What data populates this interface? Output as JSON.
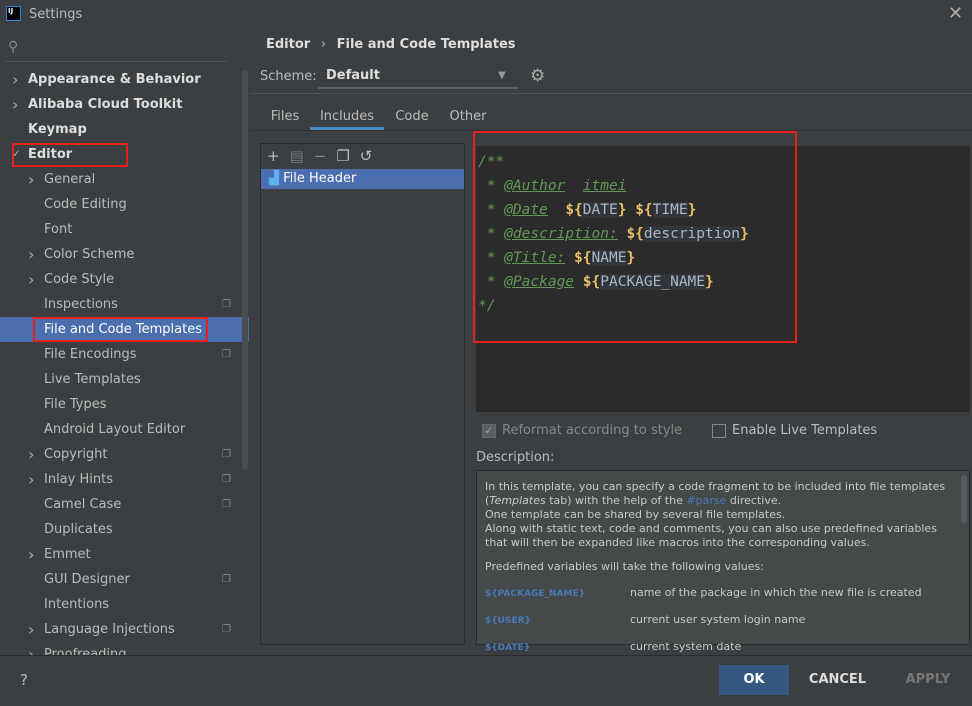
{
  "window": {
    "title": "Settings",
    "logo": "IJ"
  },
  "search": {
    "placeholder": ""
  },
  "sidebar": {
    "items": [
      {
        "label": "Appearance & Behavior",
        "level": 0,
        "chevron": true,
        "bold": true
      },
      {
        "label": "Alibaba Cloud Toolkit",
        "level": 0,
        "chevron": true,
        "bold": true
      },
      {
        "label": "Keymap",
        "level": 0,
        "chevron": false,
        "bold": true
      },
      {
        "label": "Editor",
        "level": 0,
        "expanded": true,
        "bold": true
      },
      {
        "label": "General",
        "level": 1,
        "chevron": true
      },
      {
        "label": "Code Editing",
        "level": 1
      },
      {
        "label": "Font",
        "level": 1
      },
      {
        "label": "Color Scheme",
        "level": 1,
        "chevron": true
      },
      {
        "label": "Code Style",
        "level": 1,
        "chevron": true
      },
      {
        "label": "Inspections",
        "level": 1,
        "copy": true
      },
      {
        "label": "File and Code Templates",
        "level": 1,
        "selected": true
      },
      {
        "label": "File Encodings",
        "level": 1,
        "copy": true
      },
      {
        "label": "Live Templates",
        "level": 1
      },
      {
        "label": "File Types",
        "level": 1
      },
      {
        "label": "Android Layout Editor",
        "level": 1
      },
      {
        "label": "Copyright",
        "level": 1,
        "chevron": true,
        "copy": true
      },
      {
        "label": "Inlay Hints",
        "level": 1,
        "chevron": true,
        "copy": true
      },
      {
        "label": "Camel Case",
        "level": 1,
        "copy": true
      },
      {
        "label": "Duplicates",
        "level": 1
      },
      {
        "label": "Emmet",
        "level": 1,
        "chevron": true
      },
      {
        "label": "GUI Designer",
        "level": 1,
        "copy": true
      },
      {
        "label": "Intentions",
        "level": 1
      },
      {
        "label": "Language Injections",
        "level": 1,
        "chevron": true,
        "copy": true
      },
      {
        "label": "Proofreading",
        "level": 1,
        "chevron": true
      }
    ]
  },
  "breadcrumb": {
    "parent": "Editor",
    "sep": "›",
    "current": "File and Code Templates"
  },
  "scheme": {
    "label": "Scheme:",
    "value": "Default"
  },
  "tabs": [
    "Files",
    "Includes",
    "Code",
    "Other"
  ],
  "active_tab": "Includes",
  "templates": {
    "items": [
      "File Header"
    ],
    "selected": "File Header"
  },
  "editor": {
    "lines": [
      [
        [
          "cm",
          "/**"
        ]
      ],
      [
        [
          "cm",
          " * "
        ],
        [
          "tag",
          "@Author"
        ],
        [
          "cm",
          "  "
        ],
        [
          "tag",
          "itmei"
        ]
      ],
      [
        [
          "cm",
          " * "
        ],
        [
          "tag",
          "@Date"
        ],
        [
          "cm",
          "  "
        ],
        [
          "brc",
          "${"
        ],
        [
          "var",
          "DATE"
        ],
        [
          "brc",
          "}"
        ],
        [
          "cm",
          " "
        ],
        [
          "brc",
          "${"
        ],
        [
          "var",
          "TIME"
        ],
        [
          "brc",
          "}"
        ]
      ],
      [
        [
          "cm",
          " * "
        ],
        [
          "tag",
          "@description:"
        ],
        [
          "cm",
          " "
        ],
        [
          "brc",
          "${"
        ],
        [
          "var",
          "description"
        ],
        [
          "brc",
          "}"
        ]
      ],
      [
        [
          "cm",
          " * "
        ],
        [
          "tag",
          "@Title:"
        ],
        [
          "cm",
          " "
        ],
        [
          "brc",
          "${"
        ],
        [
          "var",
          "NAME"
        ],
        [
          "brc",
          "}"
        ]
      ],
      [
        [
          "cm",
          " * "
        ],
        [
          "tag",
          "@Package"
        ],
        [
          "cm",
          " "
        ],
        [
          "brc",
          "${"
        ],
        [
          "var",
          "PACKAGE_NAME"
        ],
        [
          "brc",
          "}"
        ]
      ],
      [
        [
          "cm",
          "*/"
        ]
      ]
    ]
  },
  "options": {
    "reformat": {
      "label": "Reformat according to style",
      "checked": true,
      "disabled": true
    },
    "live_templates": {
      "label": "Enable Live Templates",
      "checked": false
    }
  },
  "description": {
    "label": "Description:",
    "p1a": "In this template, you can specify a code fragment to be included into file templates (",
    "p1b": "Templates",
    "p1c": " tab) with the help of the ",
    "p1d": "#parse",
    "p1e": " directive.",
    "p2": "One template can be shared by several file templates.",
    "p3": "Along with static text, code and comments, you can also use predefined variables that will then be expanded like macros into the corresponding values.",
    "p4": "Predefined variables will take the following values:",
    "vars": [
      {
        "name": "${PACKAGE_NAME}",
        "desc": "name of the package in which the new file is created"
      },
      {
        "name": "${USER}",
        "desc": "current user system login name"
      },
      {
        "name": "${DATE}",
        "desc": "current system date"
      }
    ]
  },
  "footer": {
    "help": "?",
    "ok": "OK",
    "cancel": "CANCEL",
    "apply": "APPLY"
  },
  "colors": {
    "accent": "#4b6eaf",
    "highlight_box": "#e5211e",
    "ok_button": "#365880"
  }
}
